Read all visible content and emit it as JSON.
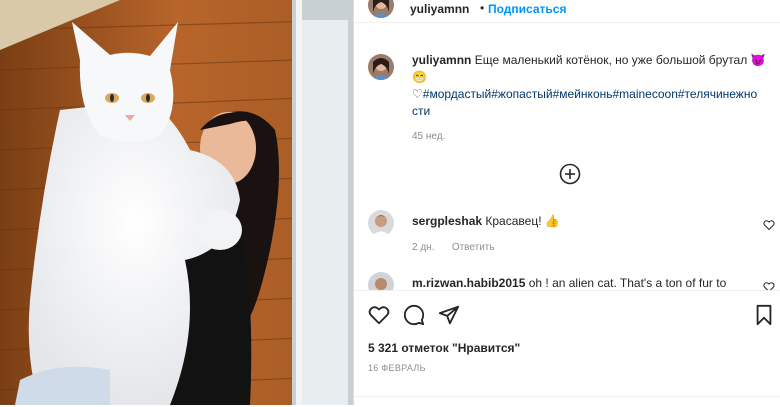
{
  "post": {
    "username": "yuliyamnn",
    "separator": "•",
    "follow_label": "Подписаться"
  },
  "caption": {
    "username": "yuliyamnn",
    "text": "Еще маленький котёнок, но уже большой брутал",
    "hashtags": "#мордастый#жопастый#мейнконь#mainecoon#телячинежно сти",
    "time": "45 нед."
  },
  "comments": [
    {
      "username": "sergpleshak",
      "text": "Красавец!",
      "time": "2 дн.",
      "reply": "Ответить"
    },
    {
      "username": "m.rizwan.habib2015",
      "text": "oh ! an alien cat. That's a ton of fur to"
    }
  ],
  "actions": {
    "likes": "5 321 отметок \"Нравится\"",
    "date": "16 ФЕВРАЛЬ"
  },
  "icons": {
    "heart": "heart-icon",
    "comment": "comment-icon",
    "share": "share-icon",
    "save": "bookmark-icon",
    "load_more": "plus-circle-icon"
  },
  "colors": {
    "link": "#0095f6",
    "hashtag": "#00376b",
    "muted": "#8e8e8e"
  }
}
